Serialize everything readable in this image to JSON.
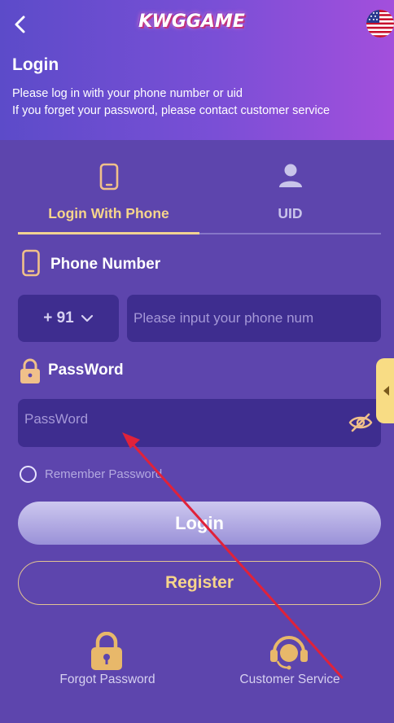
{
  "header": {
    "logo_text": "KWGGAME",
    "title": "Login",
    "subtitle_line1": "Please log in with your phone number or uid",
    "subtitle_line2": "If you forget your password, please contact customer service"
  },
  "tabs": [
    {
      "label": "Login With Phone",
      "active": true
    },
    {
      "label": "UID",
      "active": false
    }
  ],
  "phone": {
    "section_label": "Phone Number",
    "country_code": "+ 91",
    "placeholder": "Please input your phone num"
  },
  "password": {
    "section_label": "PassWord",
    "placeholder": "PassWord"
  },
  "remember_label": "Remember Password",
  "buttons": {
    "login": "Login",
    "register": "Register"
  },
  "footer": {
    "forgot_password": "Forgot Password",
    "customer_service": "Customer Service"
  },
  "colors": {
    "background": "#5d45ad",
    "accent_gold": "#f6d58b",
    "input_bg": "#3e2d8f",
    "annotation_arrow": "#e0223a"
  },
  "icons": [
    "back-arrow-icon",
    "us-flag-icon",
    "phone-icon",
    "user-icon",
    "lock-icon",
    "eye-slash-icon",
    "headset-icon",
    "chevron-down-icon",
    "chevron-left-icon"
  ]
}
